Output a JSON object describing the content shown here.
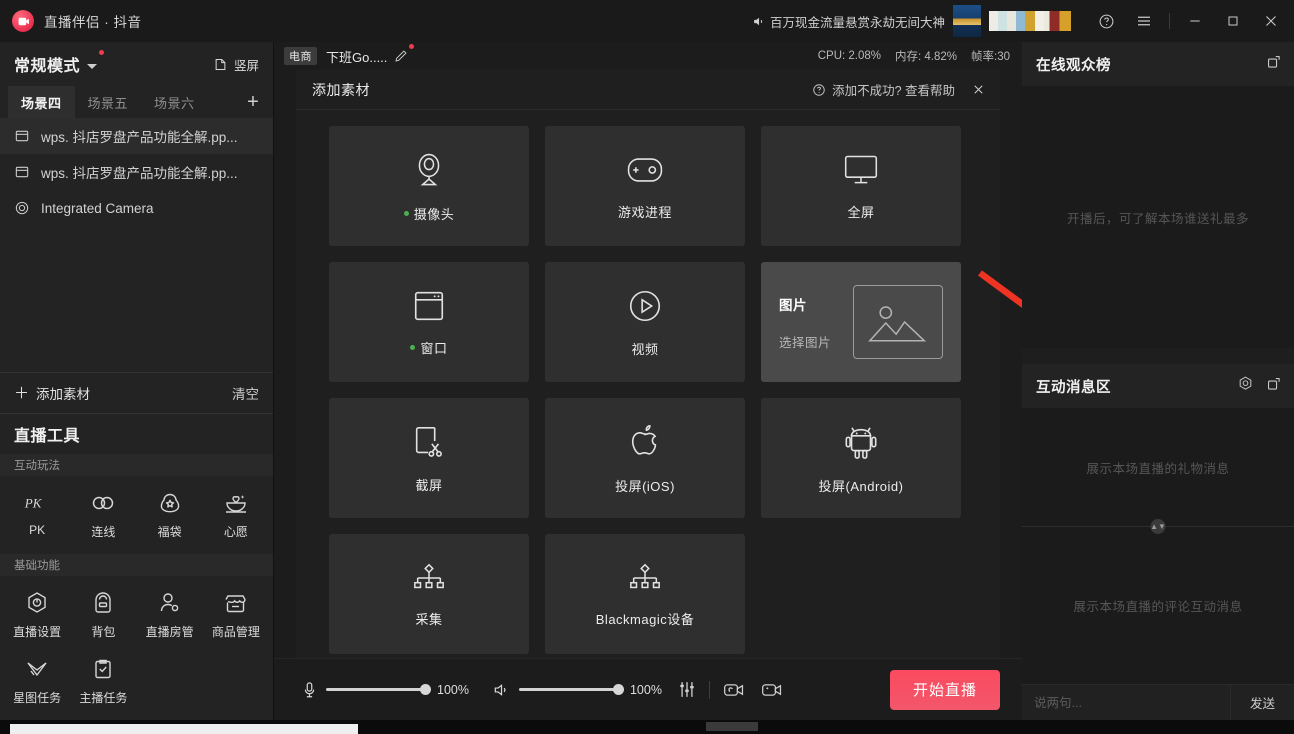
{
  "titlebar": {
    "app_title": "直播伴侣 · 抖音",
    "marquee_text": "百万现金流量悬赏永劫无间大神",
    "help_icon": "question-circle-icon",
    "menu_icon": "hamburger-menu-icon",
    "minimize_icon": "minimize-icon",
    "maximize_icon": "maximize-icon",
    "close_icon": "close-icon"
  },
  "sidebar": {
    "mode_label": "常规模式",
    "vertical_label": "竖屏",
    "scene_tabs": [
      {
        "label": "场景四",
        "active": true
      },
      {
        "label": "场景五",
        "active": false
      },
      {
        "label": "场景六",
        "active": false
      }
    ],
    "add_scene_label": "+",
    "sources": [
      {
        "label": "wps. 抖店罗盘产品功能全解.pp...",
        "icon": "window-source-icon",
        "selected": true
      },
      {
        "label": "wps. 抖店罗盘产品功能全解.pp...",
        "icon": "window-source-icon",
        "selected": false
      },
      {
        "label": "Integrated Camera",
        "icon": "camera-source-icon",
        "selected": false
      }
    ],
    "add_material_label": "添加素材",
    "clear_label": "清空",
    "tools_title": "直播工具",
    "groups": [
      {
        "title": "互动玩法",
        "items": [
          {
            "label": "PK",
            "icon": "pk-icon"
          },
          {
            "label": "连线",
            "icon": "link-icon"
          },
          {
            "label": "福袋",
            "icon": "lucky-bag-icon"
          },
          {
            "label": "心愿",
            "icon": "wish-icon"
          }
        ]
      },
      {
        "title": "基础功能",
        "items": [
          {
            "label": "直播设置",
            "icon": "settings-icon"
          },
          {
            "label": "背包",
            "icon": "backpack-icon"
          },
          {
            "label": "直播房管",
            "icon": "room-admin-icon"
          },
          {
            "label": "商品管理",
            "icon": "shop-icon"
          },
          {
            "label": "星图任务",
            "icon": "star-map-icon"
          },
          {
            "label": "主播任务",
            "icon": "task-checklist-icon"
          }
        ]
      }
    ]
  },
  "center": {
    "badge": "电商",
    "room_name": "下班Go.....",
    "edit_icon": "pencil-icon",
    "stats": {
      "cpu": "CPU: 2.08%",
      "memory": "内存: 4.82%",
      "fps": "帧率:30"
    },
    "dialog": {
      "title": "添加素材",
      "help_text": "添加不成功? 查看帮助",
      "help_icon": "question-circle-icon",
      "close_icon": "close-icon",
      "cards": [
        {
          "label": "摄像头",
          "icon": "webcam-icon",
          "dot": true,
          "hover": false
        },
        {
          "label": "游戏进程",
          "icon": "gamepad-icon",
          "dot": false,
          "hover": false
        },
        {
          "label": "全屏",
          "icon": "monitor-icon",
          "dot": false,
          "hover": false
        },
        {
          "label": "窗口",
          "icon": "window-icon",
          "dot": true,
          "hover": false
        },
        {
          "label": "视频",
          "icon": "play-circle-icon",
          "dot": false,
          "hover": false
        },
        {
          "label": "图片",
          "icon": "image-icon",
          "dot": false,
          "hover": true,
          "sub_label": "选择图片"
        },
        {
          "label": "截屏",
          "icon": "scissors-icon",
          "dot": false,
          "hover": false
        },
        {
          "label": "投屏(iOS)",
          "icon": "apple-icon",
          "dot": false,
          "hover": false
        },
        {
          "label": "投屏(Android)",
          "icon": "android-icon",
          "dot": false,
          "hover": false
        },
        {
          "label": "采集",
          "icon": "capture-device-icon",
          "dot": false,
          "hover": false
        },
        {
          "label": "Blackmagic设备",
          "icon": "capture-device-icon",
          "dot": false,
          "hover": false
        }
      ]
    },
    "bottom_bar": {
      "mic_icon": "microphone-icon",
      "mic_value": "100%",
      "speaker_icon": "speaker-icon",
      "speaker_value": "100%",
      "mixer_icon": "audio-mixer-icon",
      "camera_switch_icon": "camera-flip-icon",
      "camera_icon": "camera-icon",
      "start_label": "开始直播"
    },
    "collapse_icon": "chevron-right-icon"
  },
  "right": {
    "viewer_panel": {
      "title": "在线观众榜",
      "popout_icon": "popout-icon",
      "empty_hint": "开播后，可了解本场谁送礼最多"
    },
    "message_panel": {
      "title": "互动消息区",
      "settings_icon": "gear-icon",
      "popout_icon": "popout-icon",
      "gift_hint": "展示本场直播的礼物消息",
      "comment_hint": "展示本场直播的评论互动消息",
      "input_placeholder": "说两句...",
      "send_label": "发送"
    }
  },
  "colors": {
    "accent_red": "#fb4a5f",
    "annotation_arrow": "#ee3322",
    "active_green": "#4caf50",
    "panel_bg": "#1d1d1d",
    "card_bg": "#2f2f2f",
    "card_hover_bg": "#4a4a4a"
  }
}
